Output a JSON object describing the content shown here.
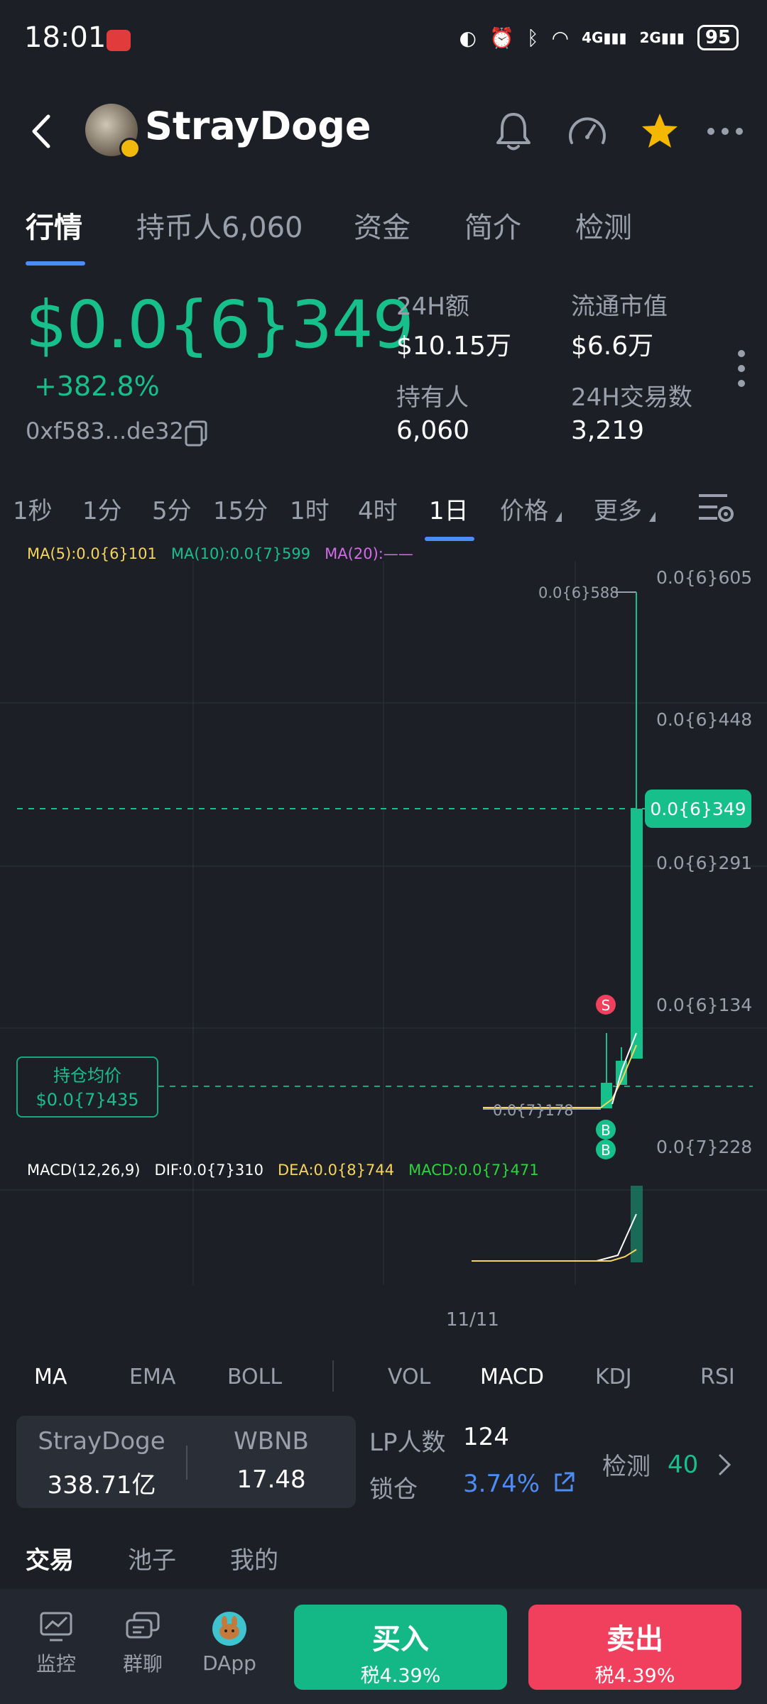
{
  "status_bar": {
    "time": "18:01",
    "network_4g": "4G",
    "network_2g": "2G",
    "battery": "95"
  },
  "header": {
    "token_name": "StrayDoge"
  },
  "tabs": [
    {
      "label": "行情"
    },
    {
      "label": "持币人6,060"
    },
    {
      "label": "资金"
    },
    {
      "label": "简介"
    },
    {
      "label": "检测"
    }
  ],
  "price": {
    "current": "$0.0{6}349",
    "change": "+382.8%",
    "address": "0xf583...de32"
  },
  "stats": {
    "volume_label": "24H额",
    "volume_value": "$10.15万",
    "mcap_label": "流通市值",
    "mcap_value": "$6.6万",
    "holders_label": "持有人",
    "holders_value": "6,060",
    "txns_label": "24H交易数",
    "txns_value": "3,219"
  },
  "intervals": [
    "1秒",
    "1分",
    "5分",
    "15分",
    "1时",
    "4时",
    "1日"
  ],
  "interval_menus": {
    "price": "价格",
    "more": "更多"
  },
  "chart_header": {
    "ma5": "MA(5):0.0{6}101",
    "ma10": "MA(10):0.0{7}599",
    "ma20": "MA(20):——",
    "macd_params": "MACD(12,26,9)",
    "dif": "DIF:0.0{7}310",
    "dea": "DEA:0.0{8}744",
    "macd": "MACD:0.0{7}471"
  },
  "chart": {
    "current_price_tag": "0.0{6}349",
    "avg_cost_label": "持仓均价",
    "avg_cost_value": "$0.0{7}435",
    "high_label": "0.0{6}588",
    "low_label": "0.0{7}178",
    "date_label": "11/11",
    "marker_sell": "S",
    "marker_buy": "B",
    "colors": {
      "up": "#17c08a",
      "ma5": "#f7d55c",
      "ma10": "#ffffff",
      "ma20": "#d46be8",
      "macd_text": "#2bd53c"
    }
  },
  "chart_data": {
    "type": "candlestick",
    "y_ticks": [
      "0.0{6}605",
      "0.0{6}448",
      "0.0{6}291",
      "0.0{6}134",
      "0.0{7}228"
    ],
    "x_ticks": [
      "11/11"
    ],
    "series": [
      {
        "name": "MA(5)",
        "last": "0.0{6}101"
      },
      {
        "name": "MA(10)",
        "last": "0.0{7}599"
      }
    ],
    "annotations": {
      "high": "0.0{6}588",
      "low": "0.0{7}178",
      "current": "0.0{6}349",
      "avg_cost": "$0.0{7}435"
    }
  },
  "indicators": [
    "MA",
    "EMA",
    "BOLL",
    "VOL",
    "MACD",
    "KDJ",
    "RSI"
  ],
  "pool": {
    "token_label": "StrayDoge",
    "token_value": "338.71亿",
    "quote_label": "WBNB",
    "quote_value": "17.48",
    "lp_label": "LP人数",
    "lp_value": "124",
    "lock_label": "锁仓",
    "lock_value": "3.74%",
    "check_label": "检测",
    "check_value": "40"
  },
  "bottom_tabs": [
    "交易",
    "池子",
    "我的"
  ],
  "bottom_nav": {
    "monitor": "监控",
    "chat": "群聊",
    "dapp": "DApp"
  },
  "actions": {
    "buy_label": "买入",
    "buy_tax": "税4.39%",
    "sell_label": "卖出",
    "sell_tax": "税4.39%"
  }
}
